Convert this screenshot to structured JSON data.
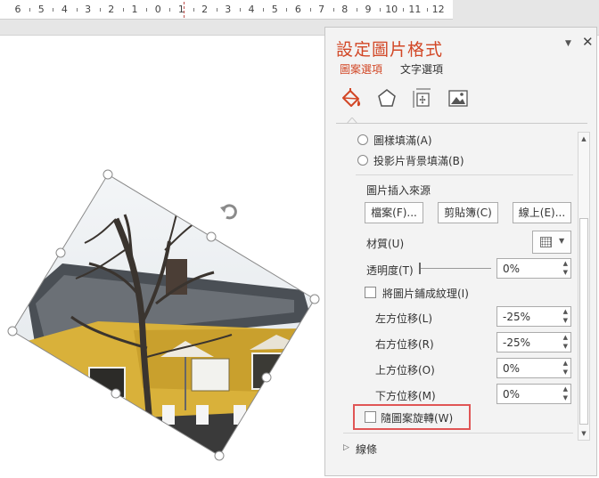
{
  "ruler": {
    "labels": [
      "6",
      "5",
      "4",
      "3",
      "2",
      "1",
      "0",
      "1",
      "2",
      "3",
      "4",
      "5",
      "6",
      "7",
      "8",
      "9",
      "10",
      "11",
      "12"
    ]
  },
  "pane": {
    "title": "設定圖片格式",
    "tabs": {
      "fill_tab": "圖案選項",
      "text_tab": "文字選項"
    },
    "options": {
      "pattern_fill": "圖樣填滿(A)",
      "slide_bg_fill": "投影片背景填滿(B)"
    },
    "insert_from": {
      "heading": "圖片插入來源",
      "file_button": "檔案(F)...",
      "clipboard_button": "剪貼簿(C)",
      "online_button": "線上(E)..."
    },
    "texture_label": "材質(U)",
    "transparency": {
      "label": "透明度(T)",
      "value": "0%"
    },
    "tile_checkbox_label": "將圖片鋪成紋理(I)",
    "offsets": {
      "left": {
        "label": "左方位移(L)",
        "value": "-25%"
      },
      "right": {
        "label": "右方位移(R)",
        "value": "-25%"
      },
      "top": {
        "label": "上方位移(O)",
        "value": "0%"
      },
      "bottom": {
        "label": "下方位移(M)",
        "value": "0%"
      }
    },
    "rotate_with_shape_label": "隨圖案旋轉(W)",
    "lines_section": "線條"
  },
  "colors": {
    "accent": "#d24726",
    "highlight": "#e05555"
  },
  "icons": {
    "fill": "paint-bucket-icon",
    "effects": "pentagon-effects-icon",
    "size": "size-properties-icon",
    "picture": "picture-icon",
    "close": "close-icon",
    "dropdown": "chevron-down-icon",
    "rotate_handle": "rotate-handle-icon"
  }
}
